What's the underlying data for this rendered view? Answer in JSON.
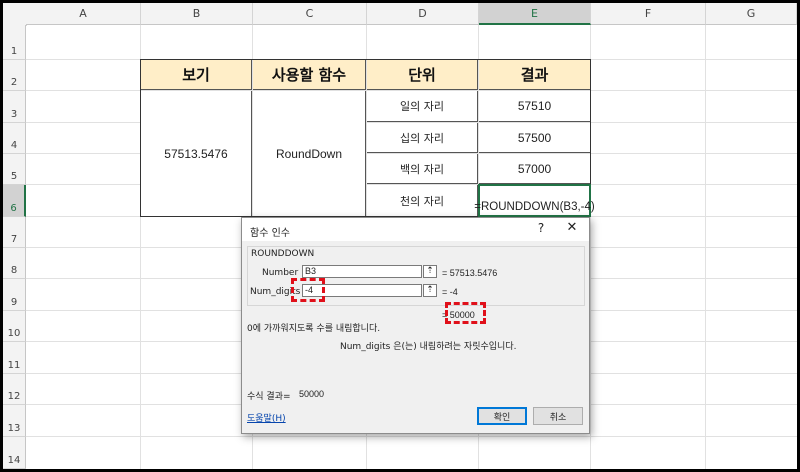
{
  "columns": [
    "A",
    "B",
    "C",
    "D",
    "E",
    "F",
    "G"
  ],
  "rows": [
    "1",
    "2",
    "3",
    "4",
    "5",
    "6",
    "7",
    "8",
    "9",
    "10",
    "11",
    "12",
    "13",
    "14"
  ],
  "table": {
    "headers": [
      "보기",
      "사용할 함수",
      "단위",
      "결과"
    ],
    "value": "57513.5476",
    "function": "RoundDown",
    "units": [
      "일의 자리",
      "십의 자리",
      "백의 자리",
      "천의 자리"
    ],
    "results": [
      "57510",
      "57500",
      "57000",
      "=ROUNDDOWN(B3,-4)"
    ]
  },
  "dialog": {
    "title": "함수 인수",
    "help_label": "?",
    "close_label": "✕",
    "function_name": "ROUNDDOWN",
    "args": [
      {
        "label": "Number",
        "input": "B3",
        "result": "= 57513.5476"
      },
      {
        "label": "Num_digits",
        "input": "-4",
        "result": "= -4"
      }
    ],
    "ref_icon": "⇡",
    "result_preview": "= 50000",
    "description": "0에 가까워지도록 수를 내림합니다.",
    "arg_description": "Num_digits  은(는) 내림하려는 자릿수입니다.",
    "formula_result_label": "수식 결과=",
    "formula_result_value": "50000",
    "help_link": "도움말(H)",
    "ok_label": "확인",
    "cancel_label": "취소"
  },
  "colors": {
    "header_fill": "#ffeec8",
    "selection_green": "#217346",
    "highlight_red": "#e0101a"
  }
}
